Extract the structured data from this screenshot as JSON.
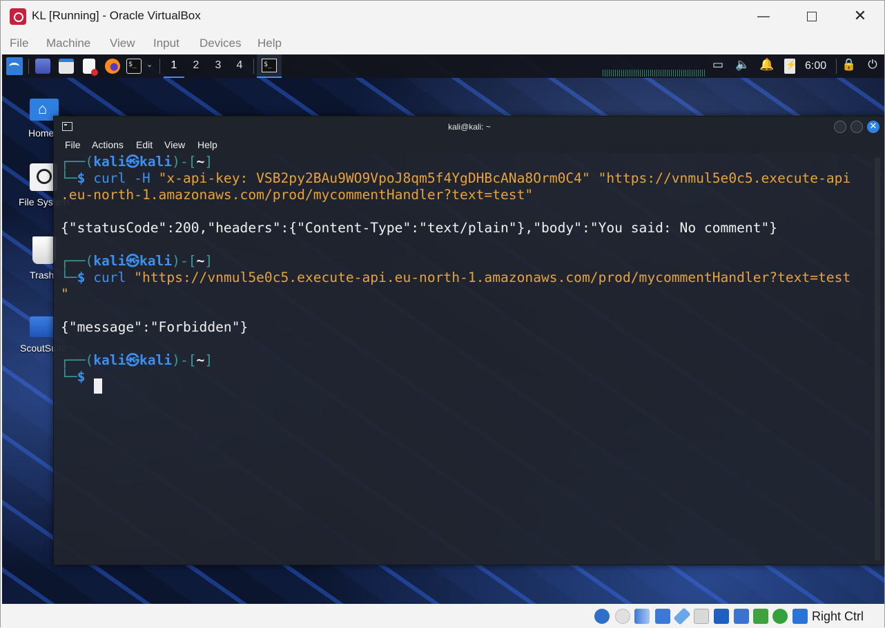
{
  "window": {
    "title": "KL [Running] - Oracle VirtualBox",
    "minimize": "—",
    "close": "✕"
  },
  "vbox_menu": [
    "File",
    "Machine",
    "View",
    "Input",
    "Devices",
    "Help"
  ],
  "kali_panel": {
    "terminal_icon_text": "$_",
    "workspaces": [
      "1",
      "2",
      "3",
      "4"
    ],
    "clock": "6:00",
    "tray_icons": [
      "display-icon",
      "volume-icon",
      "bell-icon",
      "power-icon",
      "lock-icon",
      "logout-icon"
    ]
  },
  "desktop_icons": [
    {
      "label": "Home",
      "icon": "home-folder-icon"
    },
    {
      "label": "File System",
      "icon": "drive-icon"
    },
    {
      "label": "Trash",
      "icon": "trash-icon"
    },
    {
      "label": "ScoutSuite",
      "icon": "folder-icon"
    }
  ],
  "terminal": {
    "title": "kali@kali: ~",
    "close": "✕",
    "menu": [
      "File",
      "Actions",
      "Edit",
      "View",
      "Help"
    ],
    "prompt": {
      "open": "┌──(",
      "user": "kali",
      "at": "㉿",
      "host": "kali",
      "mid": ")-[",
      "path": "~",
      "close": "]",
      "line2": "└─",
      "dollar": "$"
    },
    "commands": [
      {
        "cmd": "curl",
        "args": "-H",
        "str1": "\"x-api-key: VSB2py2BAu9WO9VpoJ8qm5f4YgDHBcANa8Orm0C4\"",
        "str2": "\"https://vnmul5e0c5.execute-api",
        "wrap": ".eu-north-1.amazonaws.com/prod/mycommentHandler?text=test\"",
        "output": "{\"statusCode\":200,\"headers\":{\"Content-Type\":\"text/plain\"},\"body\":\"You said: No comment\"}"
      },
      {
        "cmd": "curl",
        "str1": "\"https://vnmul5e0c5.execute-api.eu-north-1.amazonaws.com/prod/mycommentHandler?text=test",
        "wrap": "\"",
        "output": "{\"message\":\"Forbidden\"}"
      }
    ]
  },
  "statusbar": {
    "host_key": "Right Ctrl",
    "icons": [
      "hard-disk-icon",
      "optical-drive-icon",
      "audio-icon",
      "network-icon",
      "usb-icon",
      "shared-folders-icon",
      "display-icon",
      "recording-icon",
      "cpu-icon",
      "mouse-integration-icon",
      "keyboard-icon"
    ]
  }
}
